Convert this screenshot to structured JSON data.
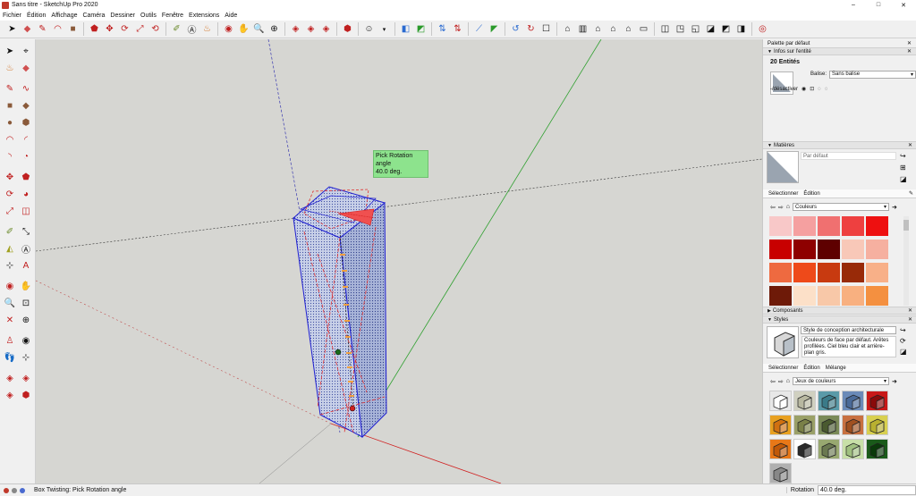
{
  "window": {
    "title": "Sans titre - SketchUp Pro 2020",
    "controls": [
      "–",
      "□",
      "✕"
    ]
  },
  "menu": [
    "Fichier",
    "Édition",
    "Affichage",
    "Caméra",
    "Dessiner",
    "Outils",
    "Fenêtre",
    "Extensions",
    "Aide"
  ],
  "viewport": {
    "tooltip_line1": "Pick Rotation angle",
    "tooltip_line2": "40.0 deg."
  },
  "tray": {
    "title": "Palette par défaut",
    "entity_info": {
      "header": "Infos sur l'entité",
      "count": "20 Entités",
      "tag_label": "Balise:",
      "tag_value": "Sans balise",
      "toggle_label": "-/désactiver"
    },
    "materials": {
      "header": "Matières",
      "name": "Par défaut",
      "tabs": [
        "Sélectionner",
        "Édition"
      ],
      "collection": "Couleurs",
      "swatches": [
        "#f8c8c8",
        "#f5a0a0",
        "#f07070",
        "#ee4040",
        "#ee1010",
        "#c80000",
        "#8e0000",
        "#5e0000",
        "#f8c8b8",
        "#f6b0a0",
        "#ee6a40",
        "#ee4a1a",
        "#c83a10",
        "#982a08",
        "#f8b088",
        "#6e1a08",
        "#fce0c8",
        "#f8c8a8",
        "#f8b080",
        "#f49040"
      ]
    },
    "components": {
      "header": "Composants"
    },
    "styles": {
      "header": "Styles",
      "name": "Style de conception architecturale",
      "description": "Couleurs de face par défaut. Arêtes profilées. Ciel bleu clair et arrière-plan gris.",
      "tabs": [
        "Sélectionner",
        "Édition",
        "Mélange"
      ],
      "collection": "Jeux de couleurs",
      "thumbs": [
        {
          "bg": "#e8e8e8",
          "face": "#ffffff"
        },
        {
          "bg": "#d0d0c0",
          "face": "#b8b8a0"
        },
        {
          "bg": "#5a9aa8",
          "face": "#3a7a88"
        },
        {
          "bg": "#6a8ab8",
          "face": "#4a6a98"
        },
        {
          "bg": "#c81818",
          "face": "#8a0a0a"
        },
        {
          "bg": "#e8a020",
          "face": "#d07010"
        },
        {
          "bg": "#9aa068",
          "face": "#7a8048"
        },
        {
          "bg": "#7a8a58",
          "face": "#4a5a30"
        },
        {
          "bg": "#c87040",
          "face": "#a05020"
        },
        {
          "bg": "#d8d050",
          "face": "#b8b030"
        },
        {
          "bg": "#e87818",
          "face": "#c05808"
        },
        {
          "bg": "#ffffff",
          "face": "#2a2a2a"
        },
        {
          "bg": "#98a870",
          "face": "#6a7850"
        },
        {
          "bg": "#c8e0a8",
          "face": "#a0c080"
        },
        {
          "bg": "#1a5a1a",
          "face": "#0a3a0a"
        },
        {
          "bg": "#b0b0b0",
          "face": "#888888"
        }
      ]
    }
  },
  "status": {
    "message": "Box Twisting: Pick Rotation angle",
    "measure_label": "Rotation",
    "measure_value": "40.0 deg."
  }
}
